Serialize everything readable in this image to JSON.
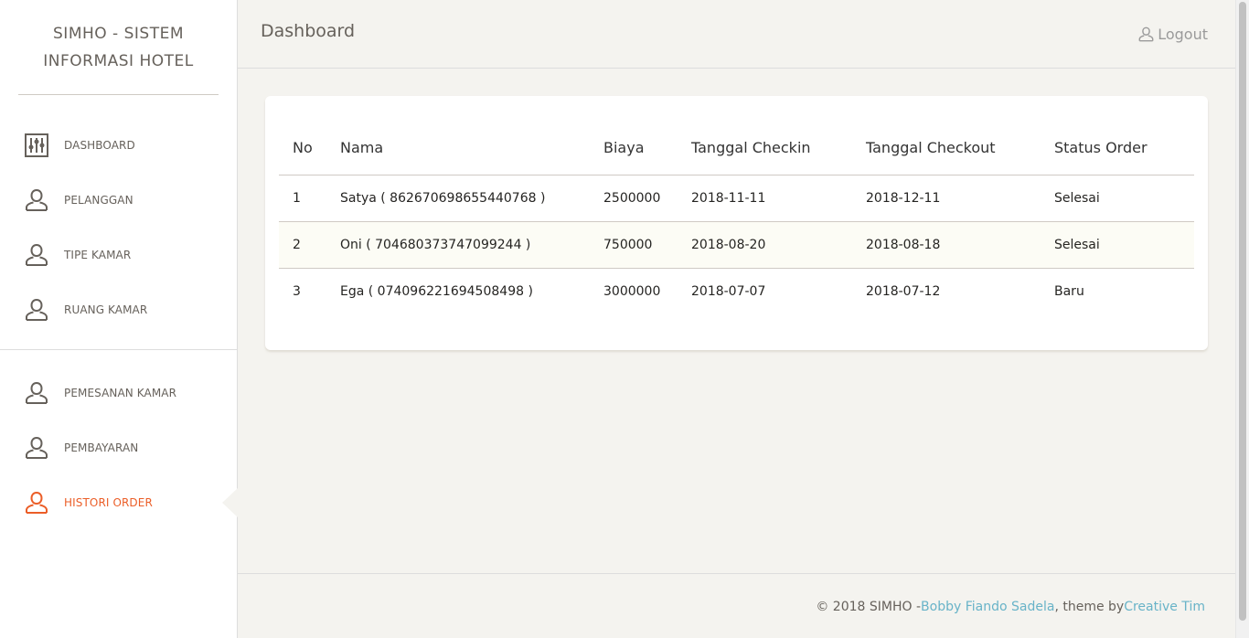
{
  "brand": {
    "title": "SIMHO - SISTEM INFORMASI HOTEL"
  },
  "sidebar": {
    "items": [
      {
        "label": "DASHBOARD",
        "icon": "panel-settings-icon"
      },
      {
        "label": "PELANGGAN",
        "icon": "user-icon"
      },
      {
        "label": "TIPE KAMAR",
        "icon": "user-icon"
      },
      {
        "label": "RUANG KAMAR",
        "icon": "user-icon"
      }
    ],
    "items2": [
      {
        "label": "PEMESANAN KAMAR",
        "icon": "user-icon"
      },
      {
        "label": "PEMBAYARAN",
        "icon": "user-icon"
      },
      {
        "label": "HISTORI ORDER",
        "icon": "user-icon",
        "active": true
      }
    ]
  },
  "header": {
    "title": "Dashboard",
    "logout_label": "Logout"
  },
  "table": {
    "columns": [
      "No",
      "Nama",
      "Biaya",
      "Tanggal Checkin",
      "Tanggal Checkout",
      "Status Order"
    ],
    "rows": [
      [
        "1",
        "Satya ( 862670698655440768 )",
        "2500000",
        "2018-11-11",
        "2018-12-11",
        "Selesai"
      ],
      [
        "2",
        "Oni ( 704680373747099244 )",
        "750000",
        "2018-08-20",
        "2018-08-18",
        "Selesai"
      ],
      [
        "3",
        "Ega ( 074096221694508498 )",
        "3000000",
        "2018-07-07",
        "2018-07-12",
        "Baru"
      ]
    ]
  },
  "footer": {
    "prefix": "© 2018 SIMHO - ",
    "author": "Bobby Fiando Sadela",
    "middle": ", theme by ",
    "theme": "Creative Tim"
  },
  "colors": {
    "accent": "#eb5e28",
    "link": "#68b3c8",
    "background": "#f4f3ef",
    "icon": "#66615b"
  }
}
